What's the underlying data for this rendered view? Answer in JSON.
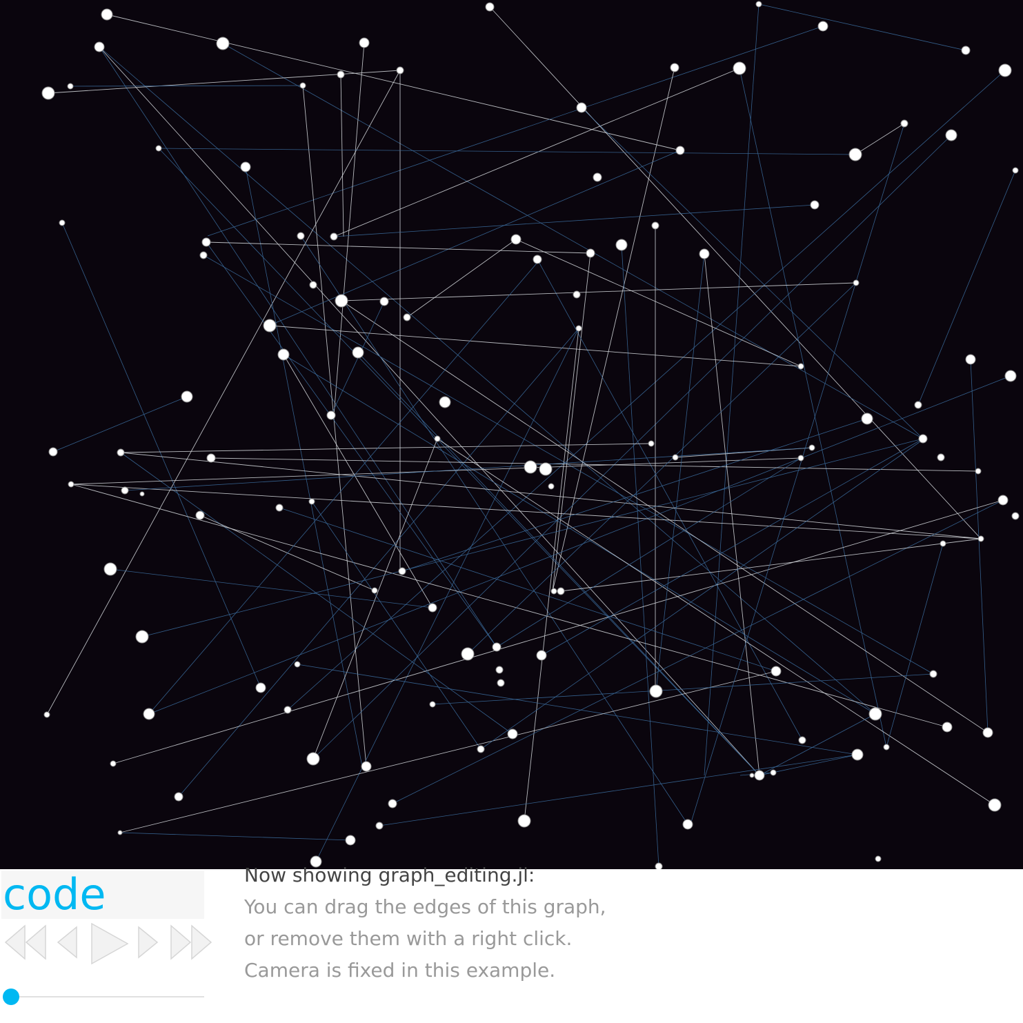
{
  "code_button": {
    "label": "code"
  },
  "player": {
    "buttons": [
      {
        "name": "skip-backward",
        "icon": "double-triangle-left-icon"
      },
      {
        "name": "step-backward",
        "icon": "triangle-left-icon"
      },
      {
        "name": "play",
        "icon": "play-icon"
      },
      {
        "name": "step-forward",
        "icon": "triangle-right-icon"
      },
      {
        "name": "skip-forward",
        "icon": "double-triangle-right-icon"
      }
    ],
    "progress": 0.0
  },
  "description": {
    "title": "Now showing graph_editing.jl:",
    "lines": [
      "You can drag the edges of this graph,",
      "or remove them with a right click.",
      "Camera is fixed in this example."
    ]
  },
  "colors": {
    "canvas_bg": "#0a050d",
    "edge_light": "#d8dce0",
    "edge_blue": "#3a6a9a",
    "node_fill": "#ffffff",
    "accent": "#00b8f2",
    "button_gray": "#d9d9d9"
  }
}
